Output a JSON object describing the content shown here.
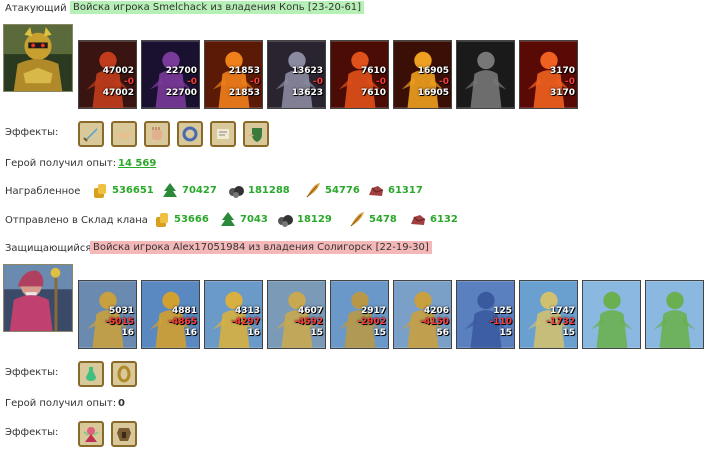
{
  "attacker": {
    "role_label": "Атакующий",
    "title": "Войска игрока Smelchack из владения Копь [23-20-61]",
    "units": [
      {
        "top": "47002",
        "mid": "-0",
        "bottom": "47002",
        "bg": "#3a1410",
        "fg": "#c23c1c"
      },
      {
        "top": "22700",
        "mid": "-0",
        "bottom": "22700",
        "bg": "#1a1030",
        "fg": "#7a3a9a"
      },
      {
        "top": "21853",
        "mid": "-0",
        "bottom": "21853",
        "bg": "#5a1a06",
        "fg": "#f0801a"
      },
      {
        "top": "13623",
        "mid": "-0",
        "bottom": "13623",
        "bg": "#2a2430",
        "fg": "#8a8aa0"
      },
      {
        "top": "7610",
        "mid": "-0",
        "bottom": "7610",
        "bg": "#4a0c04",
        "fg": "#e0501a"
      },
      {
        "top": "16905",
        "mid": "-0",
        "bottom": "16905",
        "bg": "#3a1006",
        "fg": "#f0a020"
      },
      {
        "top": "",
        "mid": "",
        "bottom": "",
        "bg": "#1a1a1a",
        "fg": "#777777"
      },
      {
        "top": "3170",
        "mid": "-0",
        "bottom": "3170",
        "bg": "#5a0a04",
        "fg": "#f06020"
      }
    ],
    "effects_label": "Эффекты:",
    "effects": [
      "sword-icon",
      "handshake-icon",
      "fist-icon",
      "ring-icon",
      "scroll-icon",
      "shield-hand-icon"
    ],
    "xp_label": "Герой получил опыт:",
    "xp_value": "14 569",
    "loot_label": "Награбленное",
    "loot": [
      {
        "icon": "gold-icon",
        "value": "536651"
      },
      {
        "icon": "wood-icon",
        "value": "70427"
      },
      {
        "icon": "ore-icon",
        "value": "181288"
      },
      {
        "icon": "feather-icon",
        "value": "54776"
      },
      {
        "icon": "stone-icon",
        "value": "61317"
      }
    ],
    "clan_label": "Отправлено в Склад клана",
    "clan": [
      {
        "icon": "gold-icon",
        "value": "53666"
      },
      {
        "icon": "wood-icon",
        "value": "7043"
      },
      {
        "icon": "ore-icon",
        "value": "18129"
      },
      {
        "icon": "feather-icon",
        "value": "5478"
      },
      {
        "icon": "stone-icon",
        "value": "6132"
      }
    ]
  },
  "defender": {
    "role_label": "Защищающийся:",
    "title": "Войска игрока Alex17051984 из владения Солигорск [22-19-30]",
    "units": [
      {
        "top": "5031",
        "mid": "-5015",
        "bottom": "16",
        "bg": "#6a8ab0",
        "fg": "#c8a040"
      },
      {
        "top": "4881",
        "mid": "-4865",
        "bottom": "16",
        "bg": "#5a88c0",
        "fg": "#d0a030"
      },
      {
        "top": "4313",
        "mid": "-4297",
        "bottom": "16",
        "bg": "#6a9ac8",
        "fg": "#d8b040"
      },
      {
        "top": "4607",
        "mid": "-4592",
        "bottom": "15",
        "bg": "#7a9ab8",
        "fg": "#c8a850"
      },
      {
        "top": "2917",
        "mid": "-2902",
        "bottom": "15",
        "bg": "#6a98c8",
        "fg": "#b89848"
      },
      {
        "top": "4206",
        "mid": "-4150",
        "bottom": "56",
        "bg": "#7aa0c8",
        "fg": "#c8a040"
      },
      {
        "top": "125",
        "mid": "-110",
        "bottom": "15",
        "bg": "#5a80c0",
        "fg": "#3a5aa0"
      },
      {
        "top": "1747",
        "mid": "-1732",
        "bottom": "15",
        "bg": "#6aa0d0",
        "fg": "#d0c070"
      },
      {
        "top": "",
        "mid": "",
        "bottom": "",
        "bg": "#8ab8e0",
        "fg": "#6ab050"
      },
      {
        "top": "",
        "mid": "",
        "bottom": "",
        "bg": "#8ab8e0",
        "fg": "#6ab050"
      }
    ],
    "effects_label": "Эффекты:",
    "effects": [
      "potion-icon",
      "ring-gold-icon"
    ],
    "xp_label": "Герой получил опыт:",
    "xp_value": "0",
    "effects2_label": "Эффекты:",
    "effects2": [
      "fairy-icon",
      "armor-icon"
    ]
  }
}
